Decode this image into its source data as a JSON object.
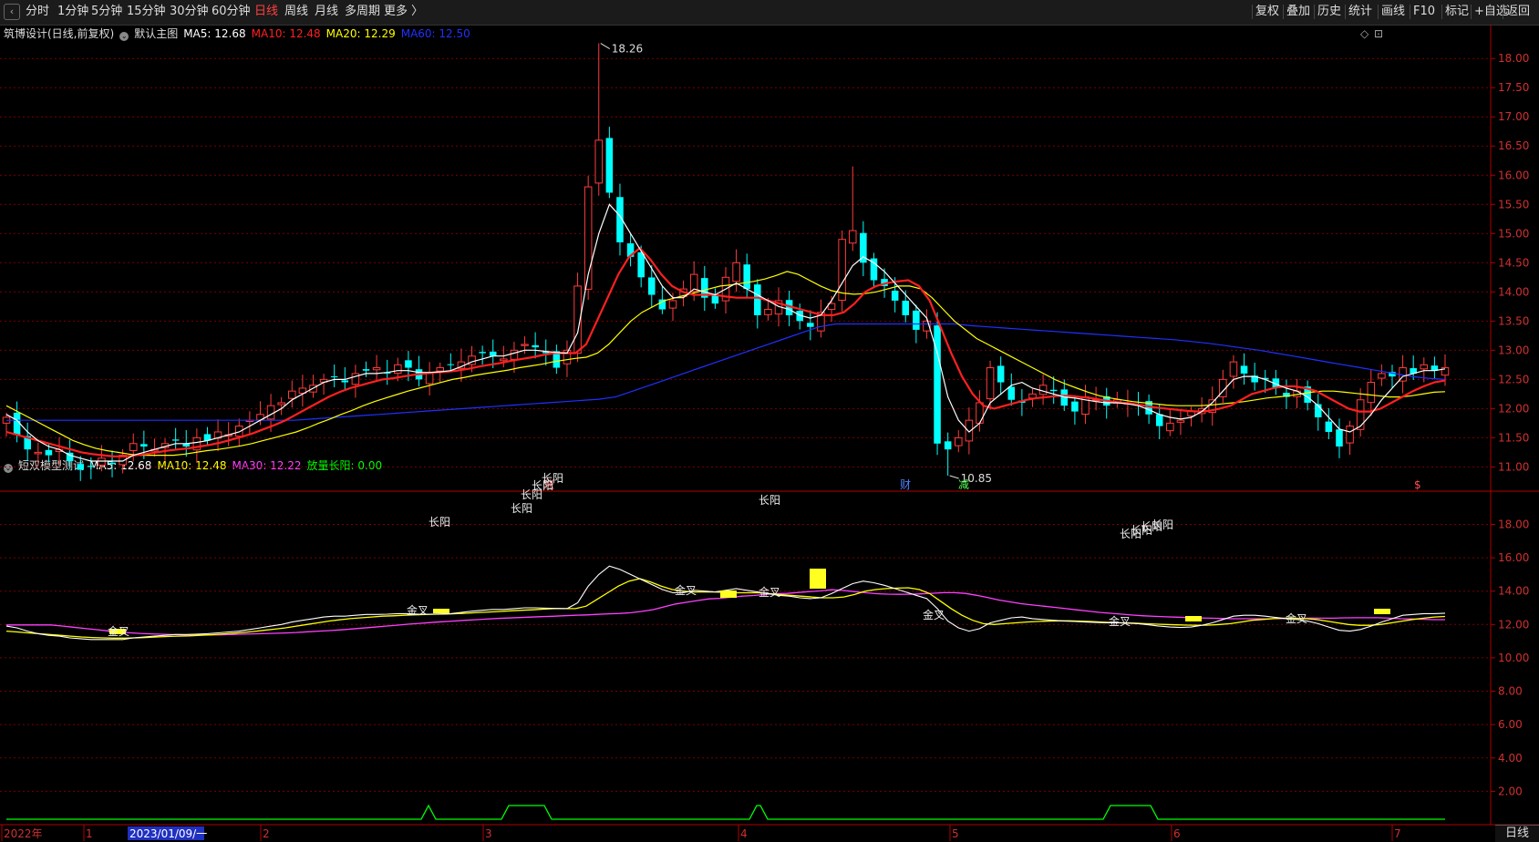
{
  "toolbar": {
    "periods": [
      "分时",
      "1分钟",
      "5分钟",
      "15分钟",
      "30分钟",
      "60分钟",
      "日线",
      "周线",
      "月线",
      "多周期",
      "更多 〉"
    ],
    "active_period": "日线",
    "right_buttons": [
      "复权",
      "叠加",
      "历史",
      "统计",
      "画线",
      "F10",
      "标记",
      "+自选",
      "返回"
    ]
  },
  "main_legend": {
    "stock": "筑博设计(日线,前复权)",
    "chart_name": "默认主图",
    "ma5": "MA5: 12.68",
    "ma10": "MA10: 12.48",
    "ma20": "MA20: 12.29",
    "ma60": "MA60: 12.50"
  },
  "sub_legend": {
    "name": "短双模型测试",
    "ma5": "MA5: 12.68",
    "ma10": "MA10: 12.48",
    "ma30": "MA30: 12.22",
    "fangliang": "放量长阳: 0.00"
  },
  "annotations": {
    "high": "18.26",
    "low": "10.85",
    "markers": [
      "涨",
      "财",
      "减",
      "$"
    ],
    "changyang": "长阳",
    "jincha": "金叉"
  },
  "bottom_tab": "日线",
  "colors": {
    "up": "#ff3c3c",
    "down": "#00ffff",
    "ma5": "#ffffff",
    "ma10": "#ff2020",
    "ma20": "#ffff00",
    "ma60": "#2030ff",
    "ma30": "#ff40ff",
    "signal": "#00ff00",
    "grid": "#7a0000"
  },
  "chart_data": [
    {
      "type": "candlestick",
      "title": "筑博设计(日线,前复权)",
      "ylim": [
        10.6,
        18.3
      ],
      "yticks": [
        "18.00",
        "17.50",
        "17.00",
        "16.50",
        "16.00",
        "15.50",
        "15.00",
        "14.50",
        "14.00",
        "13.50",
        "13.00",
        "12.50",
        "12.00",
        "11.50",
        "11.00"
      ],
      "ytick_values": [
        18,
        17.5,
        17,
        16.5,
        16,
        15.5,
        15,
        14.5,
        14,
        13.5,
        13,
        12.5,
        12,
        11.5,
        11
      ],
      "closes": [
        11.85,
        11.55,
        11.3,
        11.25,
        11.2,
        11.3,
        11.1,
        10.95,
        11.0,
        11.15,
        11.05,
        11.2,
        11.4,
        11.35,
        11.3,
        11.4,
        11.45,
        11.35,
        11.5,
        11.45,
        11.6,
        11.55,
        11.7,
        11.8,
        11.9,
        12.05,
        12.1,
        12.3,
        12.35,
        12.4,
        12.5,
        12.55,
        12.45,
        12.6,
        12.65,
        12.7,
        12.6,
        12.75,
        12.7,
        12.5,
        12.6,
        12.7,
        12.75,
        12.8,
        12.9,
        12.95,
        12.9,
        12.85,
        13.0,
        13.1,
        13.05,
        12.95,
        12.7,
        13.0,
        14.1,
        15.8,
        16.6,
        15.7,
        14.85,
        14.6,
        14.25,
        13.95,
        13.7,
        13.85,
        14.05,
        14.3,
        13.9,
        13.8,
        14.25,
        14.5,
        14.05,
        13.6,
        13.7,
        13.85,
        13.6,
        13.5,
        13.4,
        13.65,
        13.8,
        14.9,
        15.05,
        14.5,
        14.2,
        14.1,
        13.85,
        13.6,
        13.35,
        13.5,
        11.4,
        11.3,
        11.5,
        11.8,
        12.1,
        12.7,
        12.45,
        12.15,
        12.1,
        12.25,
        12.4,
        12.3,
        12.05,
        11.95,
        12.2,
        12.15,
        12.05,
        12.15,
        12.1,
        12.05,
        11.9,
        11.7,
        11.75,
        11.8,
        11.95,
        12.0,
        12.15,
        12.5,
        12.8,
        12.6,
        12.45,
        12.5,
        12.35,
        12.2,
        12.3,
        12.1,
        11.85,
        11.6,
        11.35,
        11.7,
        12.15,
        12.45,
        12.6,
        12.55,
        12.7,
        12.6,
        12.75,
        12.65,
        12.7
      ],
      "ma5": [
        11.9,
        11.8,
        11.6,
        11.45,
        11.35,
        11.3,
        11.2,
        11.15,
        11.1,
        11.1,
        11.1,
        11.1,
        11.2,
        11.25,
        11.3,
        11.35,
        11.4,
        11.4,
        11.42,
        11.45,
        11.5,
        11.55,
        11.6,
        11.7,
        11.8,
        11.9,
        12.0,
        12.15,
        12.25,
        12.35,
        12.45,
        12.5,
        12.5,
        12.55,
        12.6,
        12.6,
        12.62,
        12.65,
        12.65,
        12.62,
        12.62,
        12.63,
        12.65,
        12.72,
        12.8,
        12.85,
        12.9,
        12.9,
        12.95,
        13.0,
        13.0,
        12.98,
        12.96,
        12.95,
        13.3,
        14.3,
        15.0,
        15.5,
        15.3,
        15.0,
        14.7,
        14.4,
        14.1,
        13.9,
        13.9,
        14.05,
        14.0,
        13.95,
        14.05,
        14.15,
        14.05,
        13.95,
        13.85,
        13.75,
        13.7,
        13.6,
        13.55,
        13.6,
        13.85,
        14.15,
        14.45,
        14.6,
        14.5,
        14.35,
        14.15,
        13.95,
        13.75,
        13.55,
        12.95,
        12.2,
        11.8,
        11.6,
        11.75,
        12.1,
        12.25,
        12.4,
        12.45,
        12.35,
        12.3,
        12.25,
        12.2,
        12.18,
        12.15,
        12.12,
        12.1,
        12.1,
        12.08,
        12.05,
        11.98,
        11.9,
        11.85,
        11.82,
        11.85,
        11.95,
        12.1,
        12.3,
        12.5,
        12.55,
        12.55,
        12.5,
        12.42,
        12.35,
        12.3,
        12.2,
        12.05,
        11.85,
        11.65,
        11.6,
        11.7,
        11.9,
        12.15,
        12.35,
        12.55,
        12.6,
        12.65,
        12.65,
        12.68
      ],
      "ma10": [
        11.6,
        11.55,
        11.5,
        11.45,
        11.4,
        11.35,
        11.3,
        11.25,
        11.22,
        11.2,
        11.18,
        11.18,
        11.2,
        11.22,
        11.25,
        11.28,
        11.3,
        11.32,
        11.35,
        11.38,
        11.42,
        11.47,
        11.52,
        11.58,
        11.65,
        11.72,
        11.8,
        11.9,
        12.0,
        12.1,
        12.2,
        12.28,
        12.35,
        12.4,
        12.45,
        12.5,
        12.52,
        12.55,
        12.58,
        12.6,
        12.62,
        12.63,
        12.65,
        12.68,
        12.72,
        12.75,
        12.78,
        12.82,
        12.85,
        12.88,
        12.92,
        12.95,
        12.95,
        12.95,
        13.1,
        13.5,
        13.9,
        14.3,
        14.6,
        14.75,
        14.55,
        14.3,
        14.1,
        14.0,
        13.95,
        13.95,
        13.95,
        13.92,
        13.9,
        13.9,
        13.9,
        13.85,
        13.8,
        13.75,
        13.7,
        13.65,
        13.6,
        13.6,
        13.65,
        13.8,
        14.0,
        14.1,
        14.15,
        14.18,
        14.2,
        14.1,
        13.85,
        13.4,
        12.95,
        12.55,
        12.25,
        12.05,
        12.0,
        12.05,
        12.1,
        12.15,
        12.18,
        12.2,
        12.22,
        12.22,
        12.2,
        12.18,
        12.15,
        12.12,
        12.1,
        12.08,
        12.05,
        12.02,
        12.0,
        11.98,
        11.96,
        11.95,
        11.96,
        12.0,
        12.05,
        12.15,
        12.25,
        12.3,
        12.35,
        12.38,
        12.38,
        12.35,
        12.3,
        12.2,
        12.1,
        12.0,
        11.95,
        11.95,
        12.0,
        12.1,
        12.2,
        12.3,
        12.38,
        12.45,
        12.48
      ],
      "ma20": [
        12.05,
        11.95,
        11.85,
        11.75,
        11.65,
        11.55,
        11.45,
        11.38,
        11.32,
        11.28,
        11.25,
        11.22,
        11.2,
        11.2,
        11.2,
        11.2,
        11.22,
        11.25,
        11.28,
        11.3,
        11.33,
        11.36,
        11.4,
        11.45,
        11.5,
        11.55,
        11.6,
        11.67,
        11.75,
        11.82,
        11.9,
        11.97,
        12.05,
        12.12,
        12.18,
        12.24,
        12.3,
        12.35,
        12.4,
        12.45,
        12.5,
        12.53,
        12.57,
        12.6,
        12.63,
        12.66,
        12.7,
        12.73,
        12.76,
        12.8,
        12.83,
        12.86,
        12.88,
        12.95,
        13.1,
        13.3,
        13.5,
        13.65,
        13.75,
        13.85,
        13.9,
        13.95,
        14.0,
        14.05,
        14.1,
        14.12,
        14.15,
        14.18,
        14.22,
        14.28,
        14.35,
        14.3,
        14.2,
        14.1,
        14.02,
        13.98,
        13.96,
        13.97,
        14.0,
        14.05,
        14.1,
        14.1,
        14.05,
        13.9,
        13.7,
        13.5,
        13.35,
        13.2,
        13.1,
        13.0,
        12.9,
        12.8,
        12.7,
        12.6,
        12.5,
        12.42,
        12.35,
        12.28,
        12.22,
        12.18,
        12.15,
        12.12,
        12.1,
        12.08,
        12.06,
        12.05,
        12.05,
        12.05,
        12.06,
        12.08,
        12.1,
        12.12,
        12.15,
        12.18,
        12.2,
        12.22,
        12.25,
        12.28,
        12.3,
        12.3,
        12.28,
        12.26,
        12.24,
        12.22,
        12.2,
        12.2,
        12.22,
        12.25,
        12.28,
        12.29
      ],
      "ma60": [
        11.8,
        11.8,
        11.8,
        11.8,
        11.8,
        11.8,
        11.8,
        11.8,
        11.8,
        11.8,
        11.8,
        11.8,
        11.8,
        11.8,
        11.8,
        11.8,
        11.8,
        11.8,
        11.82,
        11.84,
        11.86,
        11.88,
        11.9,
        11.92,
        11.94,
        11.96,
        11.98,
        12.0,
        12.02,
        12.04,
        12.06,
        12.08,
        12.1,
        12.12,
        12.14,
        12.16,
        12.2,
        12.3,
        12.4,
        12.5,
        12.6,
        12.7,
        12.8,
        12.9,
        13.0,
        13.1,
        13.2,
        13.3,
        13.4,
        13.45,
        13.45,
        13.45,
        13.45,
        13.45,
        13.45,
        13.45,
        13.45,
        13.42,
        13.4,
        13.38,
        13.36,
        13.34,
        13.32,
        13.3,
        13.28,
        13.26,
        13.24,
        13.22,
        13.2,
        13.18,
        13.15,
        13.12,
        13.08,
        13.04,
        13.0,
        12.95,
        12.9,
        12.85,
        12.8,
        12.75,
        12.7,
        12.65,
        12.6,
        12.55,
        12.52,
        12.5
      ]
    },
    {
      "type": "line",
      "title": "短双模型测试",
      "ylim": [
        0,
        19.5
      ],
      "yticks": [
        "18.00",
        "16.00",
        "14.00",
        "12.00",
        "10.00",
        "8.00",
        "6.00",
        "4.00",
        "2.00"
      ],
      "ytick_values": [
        18,
        16,
        14,
        12,
        10,
        8,
        6,
        4,
        2
      ],
      "signal_pulses": [
        [
          462,
          478
        ],
        [
          550,
          605
        ],
        [
          822,
          842
        ],
        [
          1210,
          1270
        ]
      ],
      "changyang_labels": [
        [
          470,
          577
        ],
        [
          560,
          562
        ],
        [
          571,
          547
        ],
        [
          583,
          537
        ],
        [
          594,
          529
        ],
        [
          832,
          553
        ],
        [
          1228,
          590
        ],
        [
          1240,
          586
        ],
        [
          1251,
          582
        ],
        [
          1263,
          580
        ]
      ],
      "jincha_labels": [
        [
          118,
          645
        ],
        [
          446,
          622
        ],
        [
          740,
          600
        ],
        [
          832,
          602
        ],
        [
          1012,
          627
        ],
        [
          1216,
          634
        ],
        [
          1410,
          631
        ]
      ]
    }
  ]
}
